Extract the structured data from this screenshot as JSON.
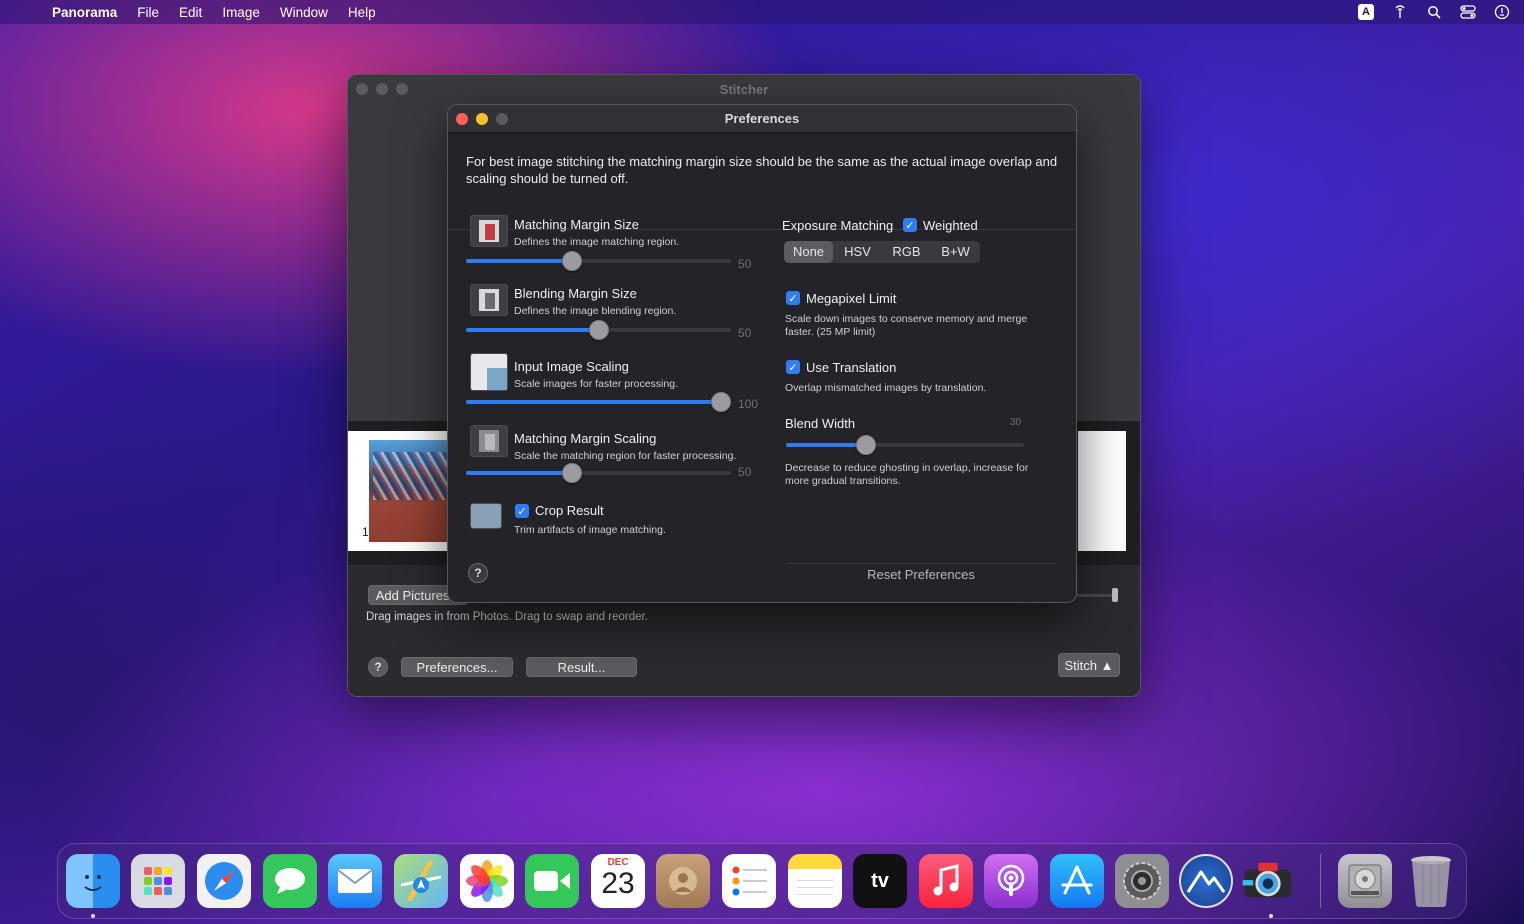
{
  "menubar": {
    "app": "Panorama",
    "items": [
      "File",
      "Edit",
      "Image",
      "Window",
      "Help"
    ],
    "status_icons": [
      "keyboard-a-icon",
      "antenna-icon",
      "search-icon",
      "control-center-icon",
      "siri-icon"
    ],
    "keyboard_label": "A"
  },
  "stitcher": {
    "title": "Stitcher",
    "thumbnail_index": "1",
    "add_pictures_label": "Add Pictures...",
    "hint": "Drag images in from Photos. Drag to swap and reorder.",
    "help_label": "?",
    "preferences_label": "Preferences...",
    "result_label": "Result...",
    "stitch_label": "Stitch ▲"
  },
  "preferences": {
    "title": "Preferences",
    "description": "For best image stitching the matching margin size should be the same as the actual image overlap and scaling should be turned off.",
    "settings": [
      {
        "title": "Matching Margin Size",
        "subtitle": "Defines the image matching region.",
        "value": "50",
        "fraction": 0.39
      },
      {
        "title": "Blending Margin Size",
        "subtitle": "Defines the image blending region.",
        "value": "50",
        "fraction": 0.5
      },
      {
        "title": "Input Image Scaling",
        "subtitle": "Scale images for faster processing.",
        "value": "100",
        "fraction": 1.0
      },
      {
        "title": "Matching Margin Scaling",
        "subtitle": "Scale the matching region for faster processing.",
        "value": "50",
        "fraction": 0.39
      }
    ],
    "crop": {
      "label": "Crop Result",
      "subtitle": "Trim artifacts of image matching.",
      "checked": true
    },
    "exposure": {
      "label": "Exposure Matching",
      "weighted_label": "Weighted",
      "options": [
        "None",
        "HSV",
        "RGB",
        "B+W"
      ],
      "selected": "None"
    },
    "megapixel": {
      "label": "Megapixel Limit",
      "subtitle": "Scale down images to conserve memory and merge faster. (25 MP limit)",
      "checked": true
    },
    "translation": {
      "label": "Use Translation",
      "subtitle": "Overlap mismatched images by translation.",
      "checked": true
    },
    "blend_width": {
      "label": "Blend Width",
      "value": "30",
      "fraction": 0.32,
      "subtitle": "Decrease to reduce ghosting in overlap, increase for more gradual transitions."
    },
    "reset_label": "Reset Preferences",
    "help_label": "?",
    "check_glyph": "✓"
  },
  "dock": {
    "calendar_month": "DEC",
    "calendar_day": "23",
    "tv_label": "tv",
    "apps": [
      "finder-icon",
      "launchpad-icon",
      "safari-icon",
      "messages-icon",
      "mail-icon",
      "maps-icon",
      "photos-icon",
      "facetime-icon",
      "calendar-icon",
      "contacts-icon",
      "reminders-icon",
      "notes-icon",
      "apple-tv-icon",
      "music-icon",
      "podcasts-icon",
      "app-store-icon",
      "system-preferences-icon",
      "altitude-icon",
      "photo-booth-camera-icon",
      "disk-utility-icon",
      "trash-icon"
    ]
  }
}
